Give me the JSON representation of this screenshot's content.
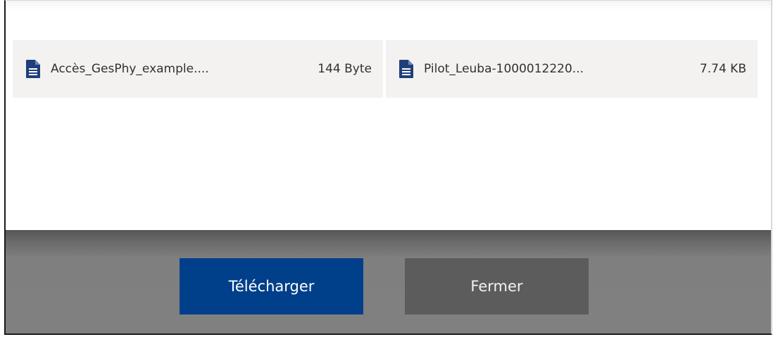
{
  "files": [
    {
      "name": "Accès_GesPhy_example....",
      "size": "144 Byte",
      "icon": "document-icon"
    },
    {
      "name": "Pilot_Leuba-1000012220...",
      "size": "7.74 KB",
      "icon": "document-icon"
    }
  ],
  "footer": {
    "download_label": "Télécharger",
    "close_label": "Fermer"
  },
  "colors": {
    "primary": "#003f8a",
    "secondary": "#5c5c5c",
    "icon": "#1f3f7a",
    "item_bg": "#f3f2f1"
  }
}
